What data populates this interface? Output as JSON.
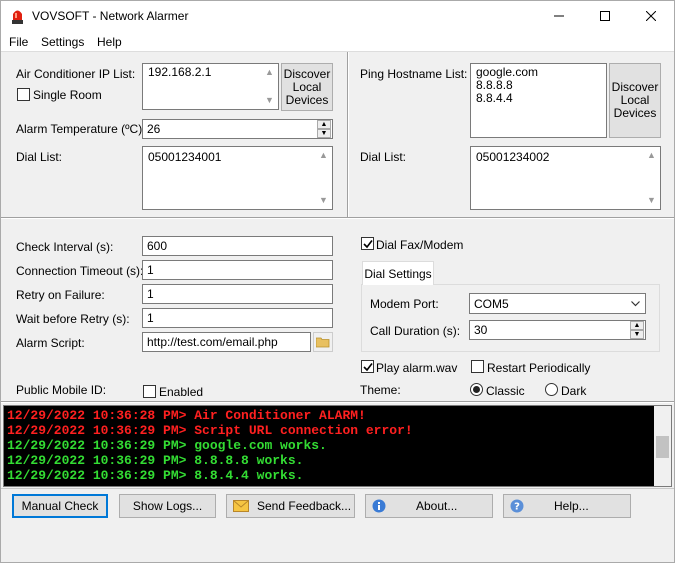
{
  "window": {
    "title": "VOVSOFT - Network Alarmer"
  },
  "menu": [
    "File",
    "Settings",
    "Help"
  ],
  "left_top": {
    "ac_ip_label": "Air Conditioner IP List:",
    "ac_ip_value": "192.168.2.1",
    "single_room_label": "Single Room",
    "single_room_checked": false,
    "discover_label": "Discover Local Devices",
    "alarm_temp_label": "Alarm Temperature (ºC):",
    "alarm_temp_value": "26",
    "dial_list_label": "Dial List:",
    "dial_list_value": "05001234001"
  },
  "right_top": {
    "ping_label": "Ping Hostname List:",
    "ping_hosts": [
      "google.com",
      "8.8.8.8",
      "8.8.4.4"
    ],
    "discover_label": "Discover Local Devices",
    "dial_list_label": "Dial List:",
    "dial_list_value": "05001234002"
  },
  "settings": {
    "check_interval_label": "Check Interval (s):",
    "check_interval_value": "600",
    "conn_timeout_label": "Connection Timeout (s):",
    "conn_timeout_value": "1",
    "retry_label": "Retry on Failure:",
    "retry_value": "1",
    "wait_label": "Wait before Retry (s):",
    "wait_value": "1",
    "script_label": "Alarm Script:",
    "script_value": "http://test.com/email.php",
    "mobile_id_label": "Public Mobile ID:",
    "enabled_label": "Enabled",
    "enabled_checked": false
  },
  "dial": {
    "dial_fax_label": "Dial Fax/Modem",
    "dial_fax_checked": true,
    "tab_label": "Dial Settings",
    "modem_port_label": "Modem Port:",
    "modem_port_value": "COM5",
    "call_duration_label": "Call Duration (s):",
    "call_duration_value": "30",
    "play_alarm_label": "Play alarm.wav",
    "play_alarm_checked": true,
    "restart_label": "Restart Periodically",
    "restart_checked": false,
    "theme_label": "Theme:",
    "classic_label": "Classic",
    "dark_label": "Dark",
    "theme_selected": "Classic"
  },
  "log": [
    {
      "text": "12/29/2022 10:36:28 PM> Air Conditioner ALARM!",
      "color": "#ff2020"
    },
    {
      "text": "12/29/2022 10:36:29 PM> Script URL connection error!",
      "color": "#ff2020"
    },
    {
      "text": "12/29/2022 10:36:29 PM> google.com works.",
      "color": "#33dd33"
    },
    {
      "text": "12/29/2022 10:36:29 PM> 8.8.8.8 works.",
      "color": "#33dd33"
    },
    {
      "text": "12/29/2022 10:36:29 PM> 8.8.4.4 works.",
      "color": "#33dd33"
    }
  ],
  "buttons": {
    "manual_check": "Manual Check",
    "show_logs": "Show Logs...",
    "send_feedback": "Send Feedback...",
    "about": "About...",
    "help": "Help..."
  }
}
